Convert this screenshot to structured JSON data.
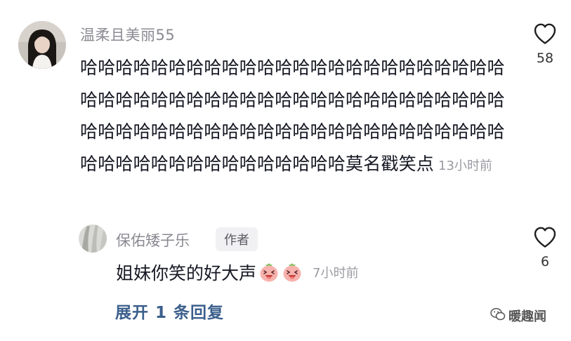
{
  "comment": {
    "username": "温柔且美丽55",
    "text": "哈哈哈哈哈哈哈哈哈哈哈哈哈哈哈哈哈哈哈哈哈哈哈哈哈哈哈哈哈哈哈哈哈哈哈哈哈哈哈哈哈哈哈哈哈哈哈哈哈哈哈哈哈哈哈哈哈哈哈哈哈哈哈哈哈哈哈哈哈哈哈哈哈哈哈哈哈哈哈哈哈哈哈哈哈哈哈莫名戳笑点",
    "time": "13小时前",
    "like_icon": "heart-outline-icon",
    "like_count": "58"
  },
  "reply": {
    "username": "保佑矮子乐",
    "badge": "作者",
    "text": "姐妹你笑的好大声",
    "emojis": [
      "laughing-peach-emoji",
      "laughing-peach-emoji"
    ],
    "time": "7小时前",
    "like_icon": "heart-outline-icon",
    "like_count": "6"
  },
  "expand_label": "展开 1 条回复",
  "watermark": {
    "icon": "wechat-logo-icon",
    "text": "暖趣闻"
  },
  "colors": {
    "name": "#8a8a92",
    "text": "#161823",
    "time": "#9a9aa2",
    "link": "#3b5f8c",
    "badge_bg": "#f1f1f3",
    "emoji": "#f6a4a4"
  }
}
